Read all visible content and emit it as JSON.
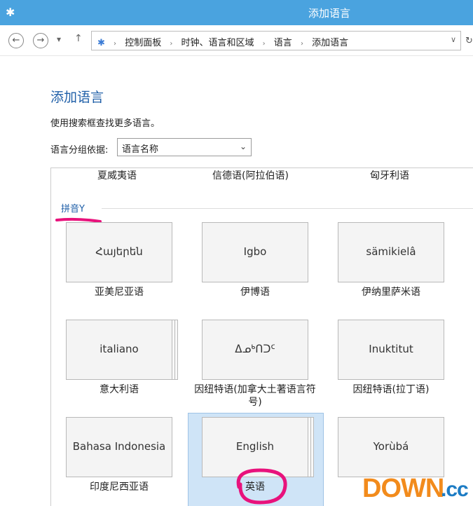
{
  "window": {
    "title": "添加语言"
  },
  "address": {
    "crumbs": [
      "控制面板",
      "时钟、语言和区域",
      "语言",
      "添加语言"
    ]
  },
  "page": {
    "title": "添加语言",
    "hint": "使用搜索框查找更多语言。",
    "group_label": "语言分组依据:",
    "group_value": "语言名称"
  },
  "list": {
    "top_row": [
      "夏威夷语",
      "信德语(阿拉伯语)",
      "匈牙利语"
    ],
    "section": "拼音Y",
    "tiles": [
      {
        "native": "Հայերեն",
        "caption": "亚美尼亚语"
      },
      {
        "native": "Igbo",
        "caption": "伊博语"
      },
      {
        "native": "sämikielâ",
        "caption": "伊纳里萨米语"
      },
      {
        "native": "italiano",
        "caption": "意大利语"
      },
      {
        "native": "ᐃᓄᒃᑎᑐᑦ",
        "caption": "因纽特语(加拿大土著语言符号)"
      },
      {
        "native": "Inuktitut",
        "caption": "因纽特语(拉丁语)"
      },
      {
        "native": "Bahasa Indonesia",
        "caption": "印度尼西亚语"
      },
      {
        "native": "English",
        "caption": "英语"
      },
      {
        "native": "Yorùbá",
        "caption": ""
      }
    ]
  },
  "watermark": {
    "text1": "DOWN",
    "text2": ".cc"
  }
}
